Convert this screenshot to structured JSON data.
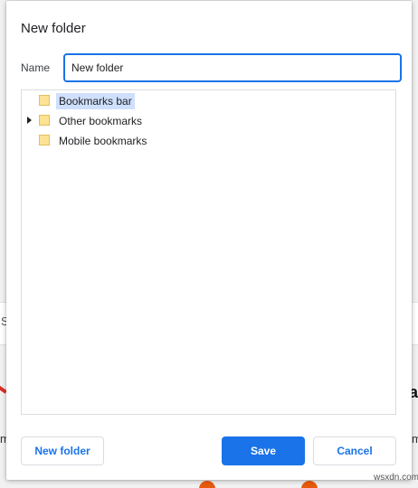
{
  "dialog": {
    "title": "New folder",
    "name_label": "Name",
    "name_value": "New folder"
  },
  "tree": {
    "items": [
      {
        "label": "Bookmarks bar",
        "selected": true,
        "expandable": false
      },
      {
        "label": "Other bookmarks",
        "selected": false,
        "expandable": true
      },
      {
        "label": "Mobile bookmarks",
        "selected": false,
        "expandable": false
      }
    ]
  },
  "buttons": {
    "new_folder": "New folder",
    "save": "Save",
    "cancel": "Cancel"
  },
  "background": {
    "partial_left_text": "S",
    "partial_left_bottom_text": "m",
    "partial_right_logo": "a",
    "partial_right_text": "m"
  },
  "watermark": "wsxdn.com",
  "colors": {
    "accent": "#1a73e8",
    "selection": "#cfe0fc",
    "folder_fill": "#fde293",
    "folder_stroke": "#e1c060"
  }
}
